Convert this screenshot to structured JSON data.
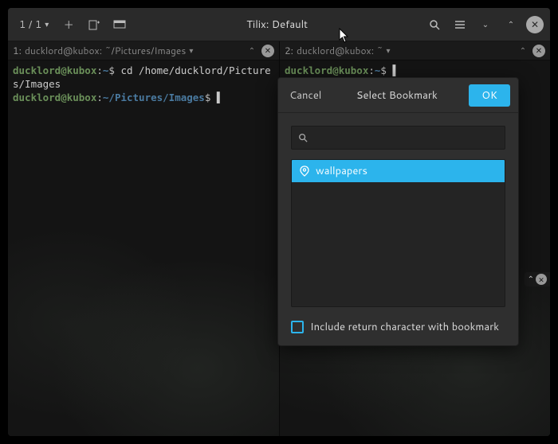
{
  "header": {
    "session": "1 / 1",
    "title": "Tilix: Default"
  },
  "panes": {
    "left": {
      "index": "1:",
      "title": "ducklord@kubox: ~/Pictures/Images",
      "prompt_user": "ducklord@kubox",
      "prompt_path1": "~",
      "cmd1": "cd /home/ducklord/Pictures/Images",
      "prompt_path2": "~/Pictures/Images"
    },
    "right": {
      "index": "2:",
      "title": "ducklord@kubox: ~",
      "prompt_user": "ducklord@kubox",
      "prompt_path": "~"
    }
  },
  "dialog": {
    "cancel": "Cancel",
    "title": "Select Bookmark",
    "ok": "OK",
    "bookmark": "wallpapers",
    "include_return": "Include return character with bookmark"
  }
}
